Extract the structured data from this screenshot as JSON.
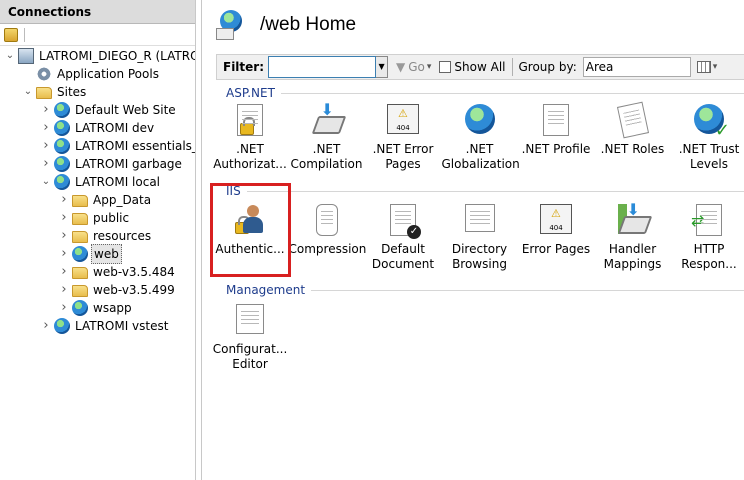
{
  "connections": {
    "title": "Connections",
    "tree": [
      {
        "label": "LATROMI_DIEGO_R (LATROMI",
        "level": 0,
        "icon": "server-icon",
        "expanded": true
      },
      {
        "label": "Application Pools",
        "level": 1,
        "icon": "app-pools-icon",
        "expanded": null
      },
      {
        "label": "Sites",
        "level": 1,
        "icon": "sites-folder-icon",
        "expanded": true
      },
      {
        "label": "Default Web Site",
        "level": 2,
        "icon": "globe-icon",
        "expanded": false
      },
      {
        "label": "LATROMI dev",
        "level": 2,
        "icon": "globe-icon",
        "expanded": false
      },
      {
        "label": "LATROMI essentials_l",
        "level": 2,
        "icon": "globe-icon",
        "expanded": false
      },
      {
        "label": "LATROMI garbage",
        "level": 2,
        "icon": "globe-icon",
        "expanded": false
      },
      {
        "label": "LATROMI local",
        "level": 2,
        "icon": "globe-icon",
        "expanded": true
      },
      {
        "label": "App_Data",
        "level": 3,
        "icon": "folder-icon",
        "expanded": false
      },
      {
        "label": "public",
        "level": 3,
        "icon": "folder-icon",
        "expanded": false
      },
      {
        "label": "resources",
        "level": 3,
        "icon": "folder-icon",
        "expanded": false
      },
      {
        "label": "web",
        "level": 3,
        "icon": "web-app-icon",
        "expanded": false,
        "selected": true
      },
      {
        "label": "web-v3.5.484",
        "level": 3,
        "icon": "folder-icon",
        "expanded": false
      },
      {
        "label": "web-v3.5.499",
        "level": 3,
        "icon": "folder-icon",
        "expanded": false
      },
      {
        "label": "wsapp",
        "level": 3,
        "icon": "web-app-icon",
        "expanded": false
      },
      {
        "label": "LATROMI vstest",
        "level": 2,
        "icon": "globe-icon",
        "expanded": false
      }
    ]
  },
  "main": {
    "title": "/web Home",
    "filter": {
      "label": "Filter:",
      "value": "",
      "go_label": "Go",
      "show_all_label": "Show All",
      "group_by_label": "Group by:",
      "group_by_value": "Area"
    },
    "sections": [
      {
        "name": "ASP.NET",
        "features": [
          {
            "label": ".NET Authorizat...",
            "icon": "net-authorization-icon"
          },
          {
            "label": ".NET Compilation",
            "icon": "net-compilation-icon"
          },
          {
            "label": ".NET Error Pages",
            "icon": "net-error-pages-icon"
          },
          {
            "label": ".NET Globalization",
            "icon": "net-globalization-icon"
          },
          {
            "label": ".NET Profile",
            "icon": "net-profile-icon"
          },
          {
            "label": ".NET Roles",
            "icon": "net-roles-icon"
          },
          {
            "label": ".NET Trust Levels",
            "icon": "net-trust-levels-icon"
          }
        ]
      },
      {
        "name": "IIS",
        "features": [
          {
            "label": "Authentic...",
            "icon": "authentication-icon"
          },
          {
            "label": "Compression",
            "icon": "compression-icon"
          },
          {
            "label": "Default Document",
            "icon": "default-document-icon"
          },
          {
            "label": "Directory Browsing",
            "icon": "directory-browsing-icon"
          },
          {
            "label": "Error Pages",
            "icon": "error-pages-icon"
          },
          {
            "label": "Handler Mappings",
            "icon": "handler-mappings-icon"
          },
          {
            "label": "HTTP Respon...",
            "icon": "http-response-icon"
          }
        ]
      },
      {
        "name": "Management",
        "features": [
          {
            "label": "Configurat... Editor",
            "icon": "configuration-editor-icon"
          }
        ]
      }
    ],
    "colors": {
      "section_header": "#1e3c8c",
      "highlight": "#d82020",
      "selected": "#e5e5e5"
    }
  }
}
